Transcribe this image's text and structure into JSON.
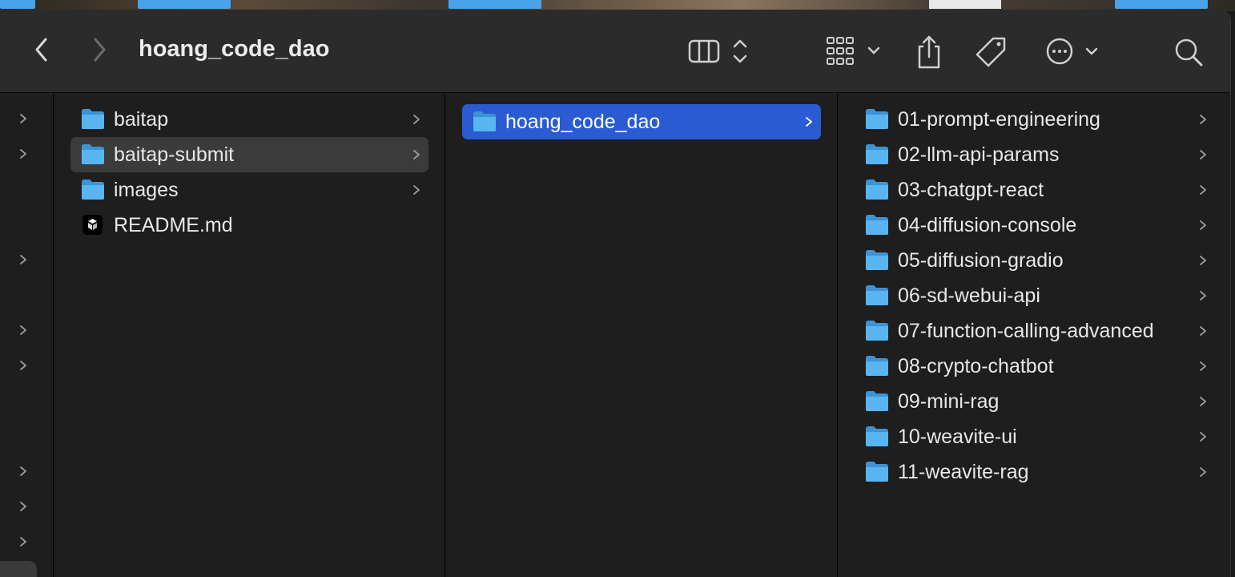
{
  "window": {
    "title": "hoang_code_dao",
    "back_label": "Back",
    "forward_label": "Forward"
  },
  "icons": {
    "back": "chevron-left-icon",
    "forward": "chevron-right-icon",
    "view": "column-view-icon",
    "group": "grid-group-icon",
    "share": "share-icon",
    "tag": "tag-icon",
    "more": "ellipsis-circle-icon",
    "search": "search-icon",
    "folder": "folder-icon",
    "markdown": "markdown-file-icon"
  },
  "colors": {
    "selection": "#2a5bd2",
    "hover": "#3b3b3b",
    "folder_front": "#5ab4f0",
    "folder_back": "#3d93d6"
  },
  "column1": {
    "items": [
      {
        "name": "baitap",
        "type": "folder"
      },
      {
        "name": "baitap-submit",
        "type": "folder"
      },
      {
        "name": "images",
        "type": "folder"
      },
      {
        "name": "README.md",
        "type": "file"
      }
    ]
  },
  "column2": {
    "items": [
      {
        "name": "hoang_code_dao",
        "type": "folder"
      }
    ]
  },
  "column3": {
    "items": [
      {
        "name": "01-prompt-engineering",
        "type": "folder"
      },
      {
        "name": "02-llm-api-params",
        "type": "folder"
      },
      {
        "name": "03-chatgpt-react",
        "type": "folder"
      },
      {
        "name": "04-diffusion-console",
        "type": "folder"
      },
      {
        "name": "05-diffusion-gradio",
        "type": "folder"
      },
      {
        "name": "06-sd-webui-api",
        "type": "folder"
      },
      {
        "name": "07-function-calling-advanced",
        "type": "folder"
      },
      {
        "name": "08-crypto-chatbot",
        "type": "folder"
      },
      {
        "name": "09-mini-rag",
        "type": "folder"
      },
      {
        "name": "10-weavite-ui",
        "type": "folder"
      },
      {
        "name": "11-weavite-rag",
        "type": "folder"
      }
    ]
  }
}
